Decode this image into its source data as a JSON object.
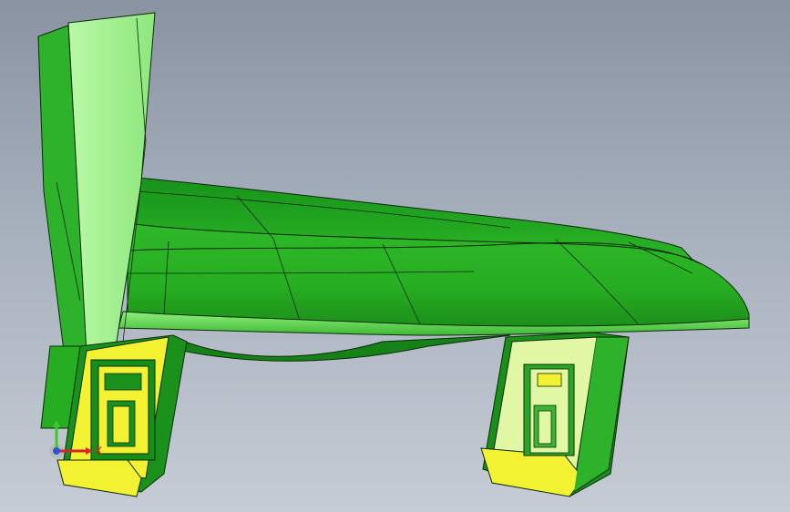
{
  "viewport": {
    "background_top": "#8a93a2",
    "background_bottom": "#c6ccd5"
  },
  "model": {
    "colors": {
      "body_green": "#22a41e",
      "body_green_dark": "#137a12",
      "body_green_light": "#4fc843",
      "panel_light": "#9ef28d",
      "clip_yellow": "#f2f233",
      "clip_pale": "#e2f7a4",
      "edge": "#0b2a08"
    }
  },
  "triad": {
    "x_label": "X",
    "x_color": "#d8262b",
    "y_color": "#38c830",
    "z_color": "#2a55d8"
  }
}
